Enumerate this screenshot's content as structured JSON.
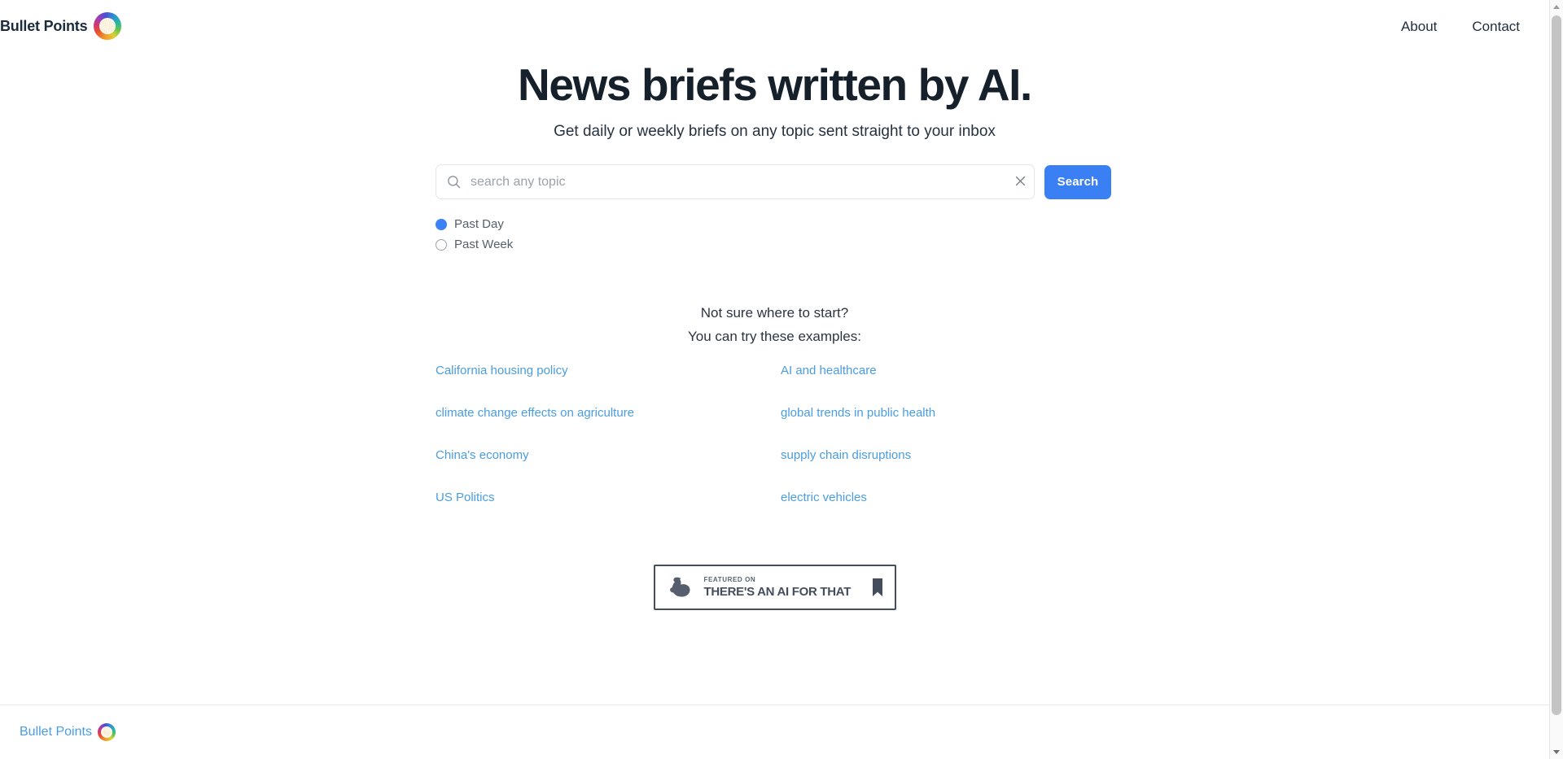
{
  "header": {
    "brand_name": "Bullet Points",
    "logo_icon": "bullet-points-logo-icon",
    "nav": [
      {
        "label": "About"
      },
      {
        "label": "Contact"
      }
    ]
  },
  "hero": {
    "headline": "News briefs written by AI.",
    "subtitle": "Get daily or weekly briefs on any topic sent straight to your inbox"
  },
  "search": {
    "icon": "search-icon",
    "value": "",
    "placeholder": "search any topic",
    "clear_icon": "close-icon",
    "button_label": "Search",
    "button_color": "#3b7ff5"
  },
  "timeframe": {
    "selected": "Past Day",
    "options": [
      {
        "label": "Past Day",
        "selected": true
      },
      {
        "label": "Past Week",
        "selected": false
      }
    ]
  },
  "examples": {
    "prompt_line_1": "Not sure where to start?",
    "prompt_line_2": "You can try these examples:",
    "link_color": "#4a9de0",
    "items": [
      {
        "label": "California housing policy"
      },
      {
        "label": "AI and healthcare"
      },
      {
        "label": "climate change effects on agriculture"
      },
      {
        "label": "global trends in public health"
      },
      {
        "label": "China's economy"
      },
      {
        "label": "supply chain disruptions"
      },
      {
        "label": "US Politics"
      },
      {
        "label": "electric vehicles"
      }
    ]
  },
  "badge": {
    "featured_label": "FEATURED ON",
    "site_name": "THERE'S AN AI FOR THAT",
    "bicep_icon": "flexed-bicep-icon",
    "bookmark_icon": "bookmark-icon",
    "border_color": "#454d5d"
  },
  "footer": {
    "brand_name": "Bullet Points",
    "logo_icon": "bullet-points-logo-icon",
    "link_color": "#4a9de0"
  }
}
